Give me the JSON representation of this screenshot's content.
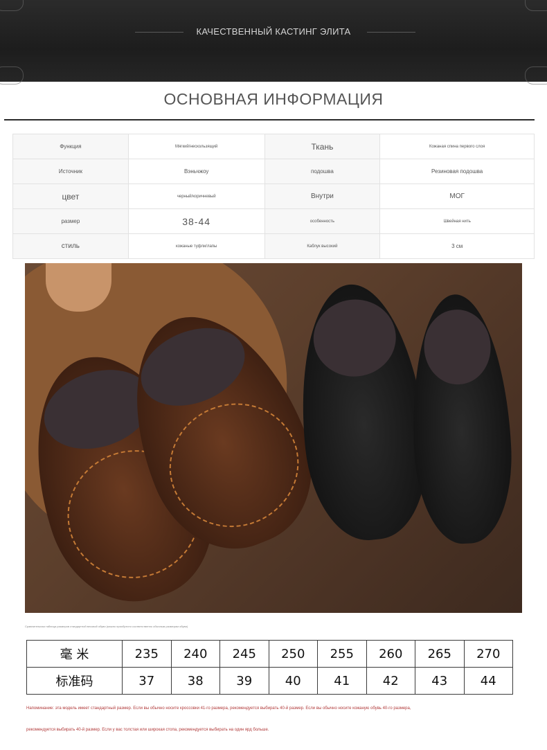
{
  "banner": {
    "title": "КАЧЕСТВЕННЫЙ КАСТИНГ ЭЛИТА"
  },
  "section": {
    "title": "ОСНОВНАЯ ИНФОРМАЦИЯ"
  },
  "info_rows": [
    {
      "k1": "Функция",
      "v1": "Мягкий/нескользящий",
      "k2": "Ткань",
      "v2": "Кожаная спина первого слоя"
    },
    {
      "k1": "Источник",
      "v1": "Вэньчжоу",
      "k2": "подошва",
      "v2": "Резиновая подошва"
    },
    {
      "k1": "цвет",
      "v1": "черный/коричневый",
      "k2": "Внутри",
      "v2": "МОГ"
    },
    {
      "k1": "размер",
      "v1": "38-44",
      "k2": "особенность",
      "v2": "Швейная нить"
    },
    {
      "k1": "стиль",
      "v1": "кожаные туфли/лапы",
      "k2": "Каблук высокий",
      "v2": "3 см"
    }
  ],
  "caption": "Сравнительная таблица размеров стандартной весовой обуви (можно приобрести соответственно обычным размерам обуви)",
  "size_table": {
    "row1_label": "毫 米",
    "row2_label": "标准码",
    "mm": [
      "235",
      "240",
      "245",
      "250",
      "255",
      "260",
      "265",
      "270"
    ],
    "std": [
      "37",
      "38",
      "39",
      "40",
      "41",
      "42",
      "43",
      "44"
    ]
  },
  "notes": {
    "line1": "Напоминание: эта модель имеет стандартный размер. Если вы обычно носите кроссовки 41-го размера, рекомендуется выбирать 40-й размер. Если вы обычно носите кожаную обувь 40-го размера,",
    "line2": "рекомендуется выбирать 40-й размер. Если у вас толстая или широкая стопа, рекомендуется выбирать на один ярд больше."
  },
  "colors": {
    "banner_bg": "#222222",
    "note_red": "#b13a3a",
    "photo_bg": "#5c3f2c"
  }
}
